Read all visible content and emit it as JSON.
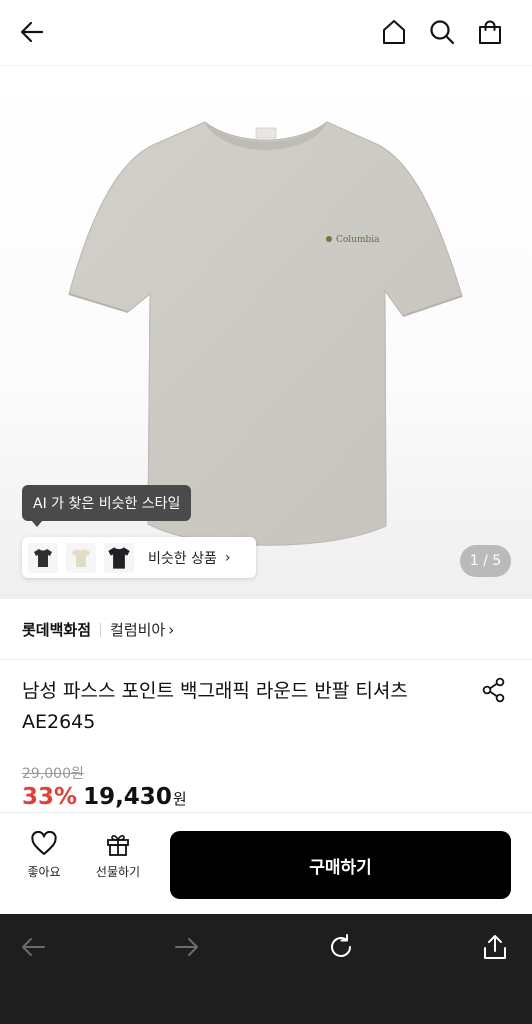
{
  "header": {
    "back_icon": "arrow-left-icon",
    "home_icon": "home-icon",
    "search_icon": "search-icon",
    "bag_icon": "shopping-bag-icon"
  },
  "gallery": {
    "image": "product-image-tshirt",
    "logo_text": "Columbia",
    "page_indicator": "1 / 5"
  },
  "ai_suggest": {
    "tooltip": "AI 가 찾은 비슷한 스타일",
    "similar_label": "비슷한 상품",
    "chevron": "›",
    "thumbnails": [
      "dark-tshirt-thumb",
      "beige-tshirt-thumb",
      "black-tshirt-thumb"
    ]
  },
  "brand": {
    "store": "롯데백화점",
    "name": "컬럼비아",
    "chevron": "›"
  },
  "product": {
    "title": "남성 파스스 포인트 백그래픽 라운드 반팔 티셔츠 AE2645",
    "original_price": "29,000원",
    "discount": "33%",
    "price": "19,430",
    "currency": "원",
    "share_icon": "share-icon"
  },
  "actions": {
    "like_label": "좋아요",
    "gift_label": "선물하기",
    "buy_label": "구매하기"
  },
  "browser": {
    "back_icon": "arrow-left-icon",
    "forward_icon": "arrow-right-icon",
    "reload_icon": "reload-icon",
    "share_icon": "share-upload-icon"
  },
  "colors": {
    "discount": "#e0403a",
    "buy_button": "#000000",
    "browser_bar": "#1e1e1e",
    "shirt": "#cbc8c2"
  }
}
